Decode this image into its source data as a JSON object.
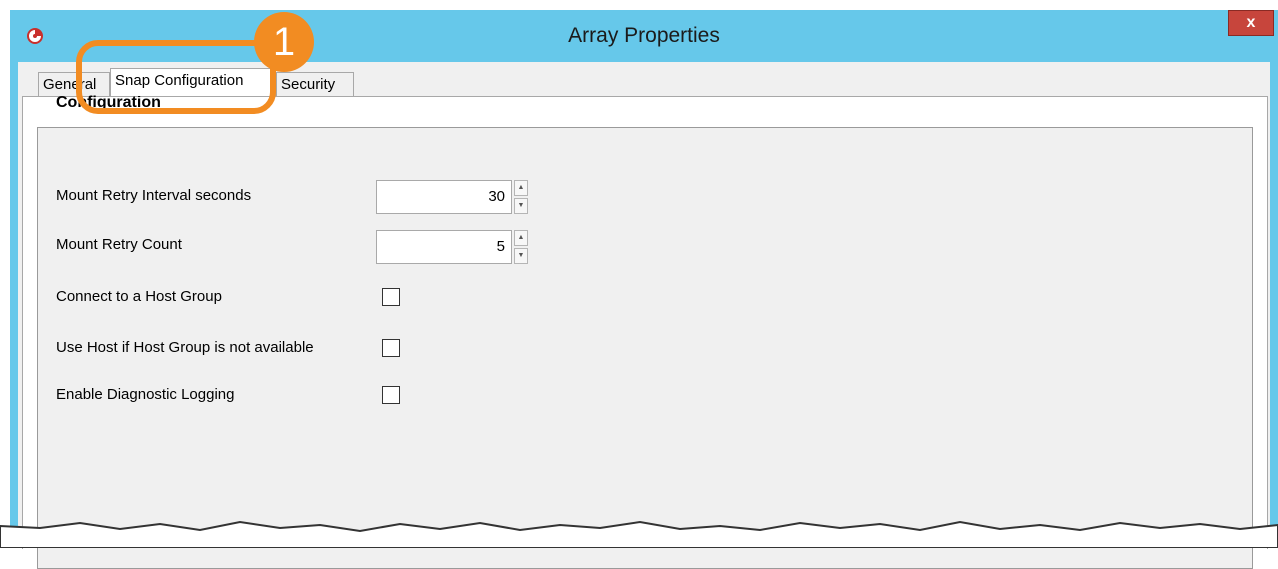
{
  "window": {
    "title": "Array Properties",
    "close_label": "x"
  },
  "tabs": [
    {
      "label": "General",
      "active": false
    },
    {
      "label": "Snap Configuration",
      "active": true
    },
    {
      "label": "Security",
      "active": false
    }
  ],
  "config": {
    "section_title": "Configuration",
    "mount_retry_interval": {
      "label": "Mount Retry Interval seconds",
      "value": "30"
    },
    "mount_retry_count": {
      "label": "Mount Retry Count",
      "value": "5"
    },
    "connect_host_group": {
      "label": "Connect to a Host Group",
      "checked": false
    },
    "use_host_fallback": {
      "label": "Use Host if Host Group is not available",
      "checked": false
    },
    "diagnostic_logging": {
      "label": "Enable Diagnostic Logging",
      "checked": false
    }
  },
  "callout": {
    "number": "1",
    "color": "#f28c22"
  },
  "colors": {
    "titlebar": "#66c8ea",
    "close": "#c7453c"
  }
}
